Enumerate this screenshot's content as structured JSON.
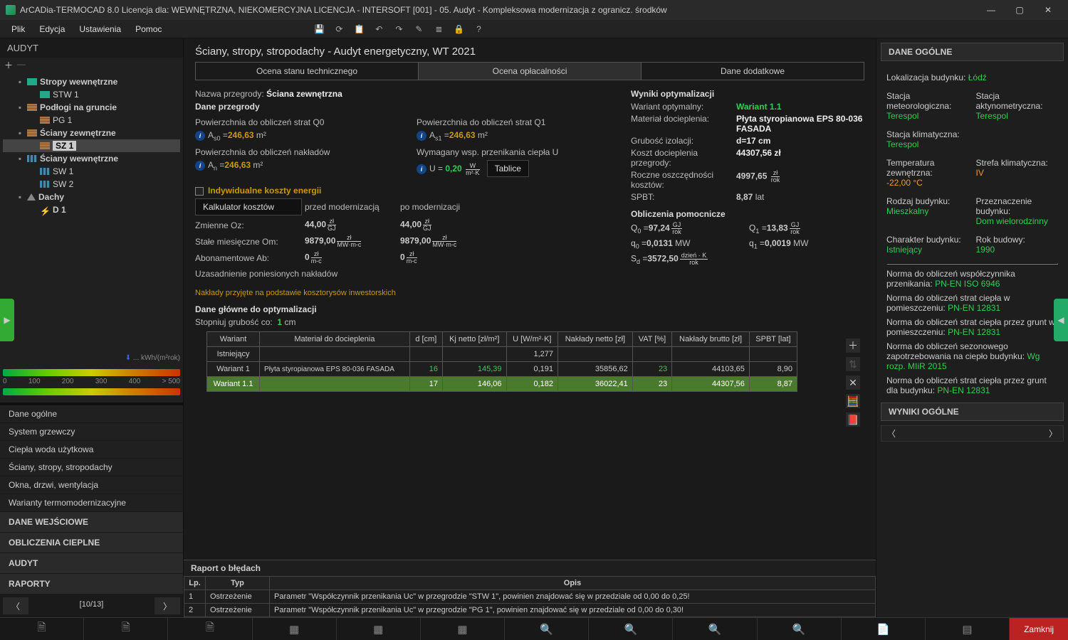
{
  "title": "ArCADia-TERMOCAD 8.0 Licencja dla: WEWNĘTRZNA, NIEKOMERCYJNA LICENCJA - INTERSOFT [001] - 05. Audyt - Kompleksowa modernizacja z ogranicz. środków",
  "menu": {
    "file": "Plik",
    "edit": "Edycja",
    "settings": "Ustawienia",
    "help": "Pomoc"
  },
  "left_title": "AUDYT",
  "tree": {
    "n0": "Stropy wewnętrzne",
    "n0a": "STW 1",
    "n1": "Podłogi na gruncie",
    "n1a": "PG 1",
    "n2": "Ściany zewnętrzne",
    "n2a": "SZ 1",
    "n3": "Ściany wewnętrzne",
    "n3a": "SW 1",
    "n3b": "SW 2",
    "n4": "Dachy",
    "n4a": "D 1"
  },
  "scale": {
    "unit": "... kWh/(m²rok)",
    "t0": "0",
    "t1": "100",
    "t2": "200",
    "t3": "300",
    "t4": "400",
    "t5": "> 500"
  },
  "side": {
    "s1": "Dane ogólne",
    "s2": "System grzewczy",
    "s3": "Ciepła woda użytkowa",
    "s4": "Ściany, stropy, stropodachy",
    "s5": "Okna, drzwi, wentylacja",
    "s6": "Warianty termomodernizacyjne",
    "h1": "DANE WEJŚCIOWE",
    "h2": "OBLICZENIA CIEPLNE",
    "h3": "AUDYT",
    "h4": "RAPORTY"
  },
  "pager": "[10/13]",
  "center_title": "Ściany, stropy, stropodachy - Audyt energetyczny, WT 2021",
  "tabs": {
    "t1": "Ocena stanu technicznego",
    "t2": "Ocena opłacalności",
    "t3": "Dane dodatkowe"
  },
  "form": {
    "name_lbl": "Nazwa przegrody:",
    "name_val": "Ściana zewnętrzna",
    "header_left": "Dane przegrody",
    "q0_lbl": "Powierzchnia do obliczeń strat Q0",
    "q0_sym": "A_s0 =",
    "q0_val": "246,63",
    "q0_unit": "m²",
    "q1_lbl": "Powierzchnia do obliczeń strat Q1",
    "q1_sym": "A_s1 =",
    "q1_val": "246,63",
    "q1_unit": "m²",
    "nakl_lbl": "Powierzchnia do obliczeń nakładów",
    "nakl_sym": "A_n =",
    "nakl_val": "246,63",
    "nakl_unit": "m²",
    "u_lbl": "Wymagany wsp. przenikania ciepła U",
    "u_sym": "U =",
    "u_val": "0,20",
    "u_unit_t": "W",
    "u_unit_b": "m²·K",
    "tablice": "Tablice",
    "chk_lbl": "Indywidualne koszty energii",
    "kalk": "Kalkulator kosztów",
    "col_before": "przed modernizacją",
    "col_after": "po modernizacji",
    "oz_lbl": "Zmienne Oz:",
    "oz_b": "44,00",
    "oz_a": "44,00",
    "oz_u_t": "zł",
    "oz_u_b": "GJ",
    "om_lbl": "Stałe miesięczne Om:",
    "om_b": "9879,00",
    "om_a": "9879,00",
    "om_u_t": "zł",
    "om_u_b": "MW·m-c",
    "ab_lbl": "Abonamentowe Ab:",
    "ab_b": "0",
    "ab_a": "0",
    "ab_u_t": "zł",
    "ab_u_b": "m-c",
    "uzas_lbl": "Uzasadnienie poniesionych nakładów",
    "uzas_val": "Nakłady przyjęte na podstawie kosztorysów inwestorskich"
  },
  "opt": {
    "header": "Wyniki optymalizacji",
    "var_lbl": "Wariant optymalny:",
    "var_val": "Wariant 1.1",
    "mat_lbl": "Materiał docieplenia:",
    "mat_val": "Płyta styropianowa EPS 80-036 FASADA",
    "grub_lbl": "Grubość izolacji:",
    "grub_val": "d=17 cm",
    "koszt_lbl": "Koszt docieplenia przegrody:",
    "koszt_val": "44307,56 zł",
    "rocz_lbl": "Roczne oszczędności kosztów:",
    "rocz_val": "4997,65",
    "rocz_u_t": "zł",
    "rocz_u_b": "rok",
    "spbt_lbl": "SPBT:",
    "spbt_val": "8,87",
    "spbt_u": "lat",
    "aux_header": "Obliczenia pomocnicze",
    "Q0_s": "Q_0 =",
    "Q0_v": "97,24",
    "Q0_ut": "GJ",
    "Q0_ub": "rok",
    "Q1_s": "Q_1 =",
    "Q1_v": "13,83",
    "Q1_ut": "GJ",
    "Q1_ub": "rok",
    "q0_s": "q_0 =",
    "q0_v": "0,0131",
    "q0_u": "MW",
    "q1_s": "q_1 =",
    "q1_v": "0,0019",
    "q1_u": "MW",
    "Sd_s": "S_d =",
    "Sd_v": "3572,50",
    "Sd_ut": "dzień · K",
    "Sd_ub": "rok"
  },
  "table": {
    "header": "Dane główne do optymalizacji",
    "step_lbl": "Stopniuj grubość co:",
    "step_val": "1",
    "step_u": "cm",
    "h1": "Wariant",
    "h2": "Materiał do docieplenia",
    "h3": "d [cm]",
    "h4": "Kj netto [zł/m²]",
    "h5": "U [W/m²·K]",
    "h6": "Nakłady netto [zł]",
    "h7": "VAT [%]",
    "h8": "Nakłady brutto [zł]",
    "h9": "SPBT [lat]",
    "r0c0": "Istniejący",
    "r0c4": "1,277",
    "r1c0": "Wariant 1",
    "r1c1": "Płyta styropianowa EPS 80-036 FASADA",
    "r1c2": "16",
    "r1c3": "145,39",
    "r1c4": "0,191",
    "r1c5": "35856,62",
    "r1c6": "23",
    "r1c7": "44103,65",
    "r1c8": "8,90",
    "r2c0": "Wariant 1.1",
    "r2c2": "17",
    "r2c3": "146,06",
    "r2c4": "0,182",
    "r2c5": "36022,41",
    "r2c6": "23",
    "r2c7": "44307,56",
    "r2c8": "8,87"
  },
  "errors": {
    "title": "Raport o błędach",
    "h1": "Lp.",
    "h2": "Typ",
    "h3": "Opis",
    "r1n": "1",
    "r1t": "Ostrzeżenie",
    "r1d": "Parametr \"Współczynnik przenikania Uc\" w przegrodzie \"STW 1\", powinien znajdować się w przedziale od 0,00 do 0,25!",
    "r2n": "2",
    "r2t": "Ostrzeżenie",
    "r2d": "Parametr \"Współczynnik przenikania Uc\" w przegrodzie \"PG 1\", powinien znajdować się w przedziale od 0,00 do 0,30!"
  },
  "right": {
    "h1": "DANE OGÓLNE",
    "loc_k": "Lokalizacja budynku:",
    "loc_v": "Łódź",
    "met_k": "Stacja meteorologiczna:",
    "met_v": "Terespol",
    "akt_k": "Stacja aktynometryczna:",
    "akt_v": "Terespol",
    "klim_k": "Stacja klimatyczna:",
    "klim_v": "Terespol",
    "temp_k": "Temperatura zewnętrzna:",
    "temp_v": "-22,00 °C",
    "strefa_k": "Strefa klimatyczna:",
    "strefa_v": "IV",
    "rodz_k": "Rodzaj budynku:",
    "rodz_v": "Mieszkalny",
    "przez_k": "Przeznaczenie budynku:",
    "przez_v": "Dom wielorodzinny",
    "char_k": "Charakter budynku:",
    "char_v": "Istniejący",
    "rok_k": "Rok budowy:",
    "rok_v": "1990",
    "n1_k": "Norma do obliczeń współczynnika przenikania:",
    "n1_v": "PN-EN ISO 6946",
    "n2_k": "Norma do obliczeń strat ciepła w pomieszczeniu:",
    "n2_v": "PN-EN 12831",
    "n3_k": "Norma do obliczeń strat ciepła przez grunt w pomieszczeniu:",
    "n3_v": "PN-EN 12831",
    "n4_k": "Norma do obliczeń sezonowego zapotrzebowania na ciepło budynku:",
    "n4_v": "Wg rozp. MIiR 2015",
    "n5_k": "Norma do obliczeń strat ciepła przez grunt dla budynku:",
    "n5_v": "PN-EN 12831",
    "h2": "WYNIKI OGÓLNE"
  },
  "footer_close": "Zamknij"
}
